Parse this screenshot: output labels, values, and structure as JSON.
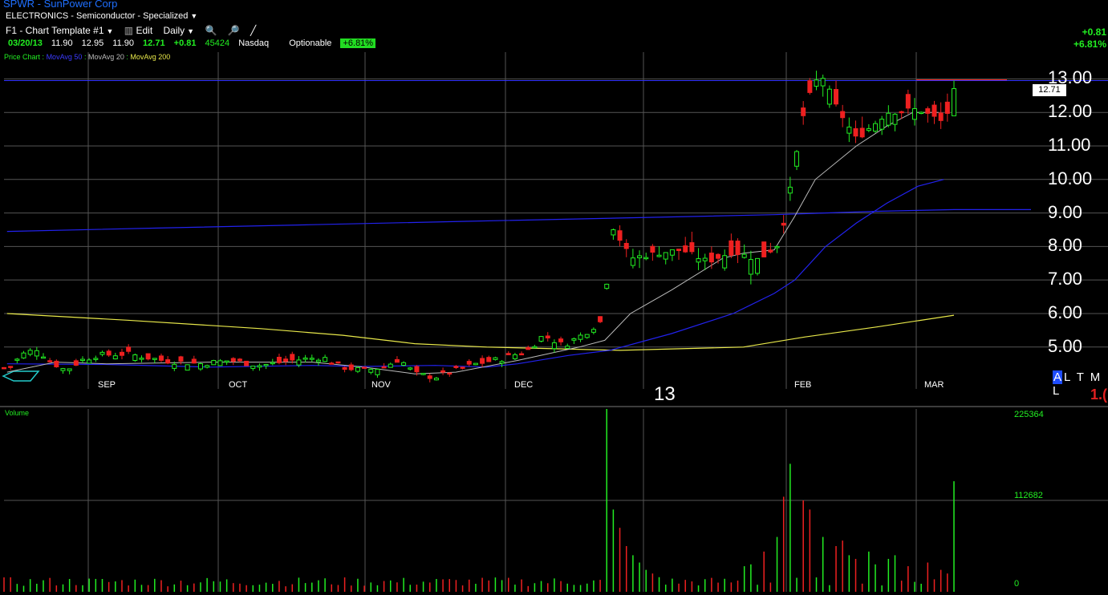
{
  "header": {
    "symbol": "SPWR",
    "company": "SunPower Corp",
    "sector": "ELECTRONICS - Semiconductor - Specialized",
    "template": "F1 - Chart Template #1",
    "edit_label": "Edit",
    "period": "Daily"
  },
  "quote": {
    "date": "03/20/13",
    "open": "11.90",
    "high": "12.95",
    "low": "11.90",
    "close": "12.71",
    "change": "+0.81",
    "volume": "45424",
    "exchange": "Nasdaq",
    "optionable": "Optionable",
    "pct_change": "+6.81%"
  },
  "right_change": {
    "change": "+0.81",
    "pct": "+6.81%"
  },
  "legend": {
    "price_chart": "Price Chart",
    "ma50": "MovAvg 50",
    "ma20": "MovAvg 20",
    "ma200": "MovAvg 200",
    "sep": ":"
  },
  "colors": {
    "up": "#22ee22",
    "down": "#ee2020",
    "ma50": "#2222ee",
    "ma20": "#bbbbbb",
    "ma200": "#e8e84a",
    "grid": "#555555"
  },
  "view_buttons": {
    "a": "A",
    "rest": "L T M L"
  },
  "red_label": "1.(",
  "chart_data": {
    "type": "candlestick",
    "price_ticks": [
      "13.00",
      "12.00",
      "11.00",
      "10.00",
      "9.00",
      "8.00",
      "7.00",
      "6.00",
      "5.00"
    ],
    "month_labels": [
      "SEP",
      "OCT",
      "NOV",
      "DEC",
      "FEB",
      "MAR"
    ],
    "year_label": "13",
    "last_price": "12.71",
    "volume_label": "Volume",
    "volume_ticks": [
      "225364",
      "112682",
      "0"
    ],
    "ylim": [
      4.0,
      13.8
    ],
    "vol_max": 225364,
    "anchors": [
      [
        4.42,
        0.006
      ],
      [
        4.78,
        0.018
      ],
      [
        4.95,
        0.032
      ],
      [
        4.58,
        0.045
      ],
      [
        4.3,
        0.06
      ],
      [
        4.6,
        0.075
      ],
      [
        4.75,
        0.09
      ],
      [
        4.8,
        0.12
      ],
      [
        4.6,
        0.155
      ],
      [
        4.5,
        0.19
      ],
      [
        4.6,
        0.22
      ],
      [
        4.45,
        0.25
      ],
      [
        4.6,
        0.28
      ],
      [
        4.7,
        0.31
      ],
      [
        4.4,
        0.33
      ],
      [
        4.3,
        0.35
      ],
      [
        4.4,
        0.37
      ],
      [
        4.65,
        0.385
      ],
      [
        4.2,
        0.4
      ],
      [
        4.1,
        0.42
      ],
      [
        4.5,
        0.46
      ],
      [
        4.65,
        0.485
      ],
      [
        4.9,
        0.51
      ],
      [
        5.35,
        0.525
      ],
      [
        5.05,
        0.545
      ],
      [
        5.4,
        0.565
      ],
      [
        5.85,
        0.585
      ],
      [
        8.75,
        0.59
      ],
      [
        7.65,
        0.61
      ],
      [
        7.8,
        0.635
      ],
      [
        7.9,
        0.66
      ],
      [
        7.55,
        0.685
      ],
      [
        7.85,
        0.71
      ],
      [
        7.6,
        0.735
      ],
      [
        8.1,
        0.755
      ],
      [
        9.6,
        0.765
      ],
      [
        12.2,
        0.78
      ],
      [
        13.2,
        0.795
      ],
      [
        12.2,
        0.81
      ],
      [
        11.2,
        0.83
      ],
      [
        12.0,
        0.86
      ],
      [
        12.1,
        0.89
      ],
      [
        11.7,
        0.915
      ],
      [
        12.5,
        0.925
      ]
    ],
    "ma200": [
      [
        0.003,
        6.0
      ],
      [
        0.12,
        5.8
      ],
      [
        0.25,
        5.55
      ],
      [
        0.33,
        5.35
      ],
      [
        0.4,
        5.1
      ],
      [
        0.47,
        5.0
      ],
      [
        0.6,
        4.9
      ],
      [
        0.72,
        5.0
      ],
      [
        0.78,
        5.3
      ],
      [
        0.85,
        5.6
      ],
      [
        0.925,
        5.95
      ]
    ],
    "ma50": [
      [
        0.003,
        8.45
      ],
      [
        0.15,
        8.55
      ],
      [
        0.3,
        8.65
      ],
      [
        0.45,
        8.75
      ],
      [
        0.6,
        8.85
      ],
      [
        0.75,
        8.95
      ],
      [
        0.85,
        9.05
      ],
      [
        0.925,
        9.1
      ],
      [
        1.0,
        9.1
      ]
    ],
    "ma50b": [
      [
        0.003,
        4.5
      ],
      [
        0.1,
        4.48
      ],
      [
        0.2,
        4.4
      ],
      [
        0.3,
        4.45
      ],
      [
        0.35,
        4.42
      ],
      [
        0.42,
        4.45
      ],
      [
        0.47,
        4.4
      ],
      [
        0.5,
        4.5
      ],
      [
        0.55,
        4.75
      ],
      [
        0.59,
        4.9
      ],
      [
        0.65,
        5.4
      ],
      [
        0.71,
        6.0
      ],
      [
        0.75,
        6.6
      ],
      [
        0.77,
        7.0
      ],
      [
        0.8,
        8.0
      ],
      [
        0.83,
        8.7
      ],
      [
        0.86,
        9.3
      ],
      [
        0.89,
        9.8
      ],
      [
        0.915,
        10.0
      ]
    ],
    "ma20": [
      [
        0.003,
        4.25
      ],
      [
        0.05,
        4.55
      ],
      [
        0.1,
        4.5
      ],
      [
        0.2,
        4.55
      ],
      [
        0.3,
        4.55
      ],
      [
        0.35,
        4.4
      ],
      [
        0.4,
        4.2
      ],
      [
        0.44,
        4.25
      ],
      [
        0.5,
        4.6
      ],
      [
        0.56,
        5.0
      ],
      [
        0.585,
        5.2
      ],
      [
        0.61,
        6.0
      ],
      [
        0.65,
        6.7
      ],
      [
        0.7,
        7.65
      ],
      [
        0.72,
        7.8
      ],
      [
        0.75,
        7.9
      ],
      [
        0.77,
        8.9
      ],
      [
        0.79,
        10.0
      ],
      [
        0.83,
        11.0
      ],
      [
        0.86,
        11.6
      ],
      [
        0.885,
        12.0
      ],
      [
        0.91,
        12.0
      ]
    ],
    "vol_spikes": [
      [
        0.589,
        1.0
      ],
      [
        0.595,
        0.45
      ],
      [
        0.6,
        0.35
      ],
      [
        0.607,
        0.25
      ],
      [
        0.613,
        0.2
      ],
      [
        0.62,
        0.16
      ],
      [
        0.626,
        0.12
      ],
      [
        0.633,
        0.1
      ],
      [
        0.64,
        0.08
      ],
      [
        0.72,
        0.14
      ],
      [
        0.725,
        0.18
      ],
      [
        0.73,
        0.15
      ],
      [
        0.74,
        0.22
      ],
      [
        0.75,
        0.3
      ],
      [
        0.757,
        0.4
      ],
      [
        0.762,
        0.52
      ],
      [
        0.768,
        0.7
      ],
      [
        0.775,
        0.72
      ],
      [
        0.78,
        0.5
      ],
      [
        0.787,
        0.45
      ],
      [
        0.795,
        0.35
      ],
      [
        0.8,
        0.3
      ],
      [
        0.81,
        0.25
      ],
      [
        0.817,
        0.28
      ],
      [
        0.823,
        0.2
      ],
      [
        0.83,
        0.18
      ],
      [
        0.84,
        0.22
      ],
      [
        0.85,
        0.15
      ],
      [
        0.86,
        0.18
      ],
      [
        0.87,
        0.2
      ],
      [
        0.88,
        0.14
      ],
      [
        0.89,
        0.12
      ],
      [
        0.9,
        0.16
      ],
      [
        0.91,
        0.12
      ],
      [
        0.92,
        0.1
      ]
    ]
  }
}
